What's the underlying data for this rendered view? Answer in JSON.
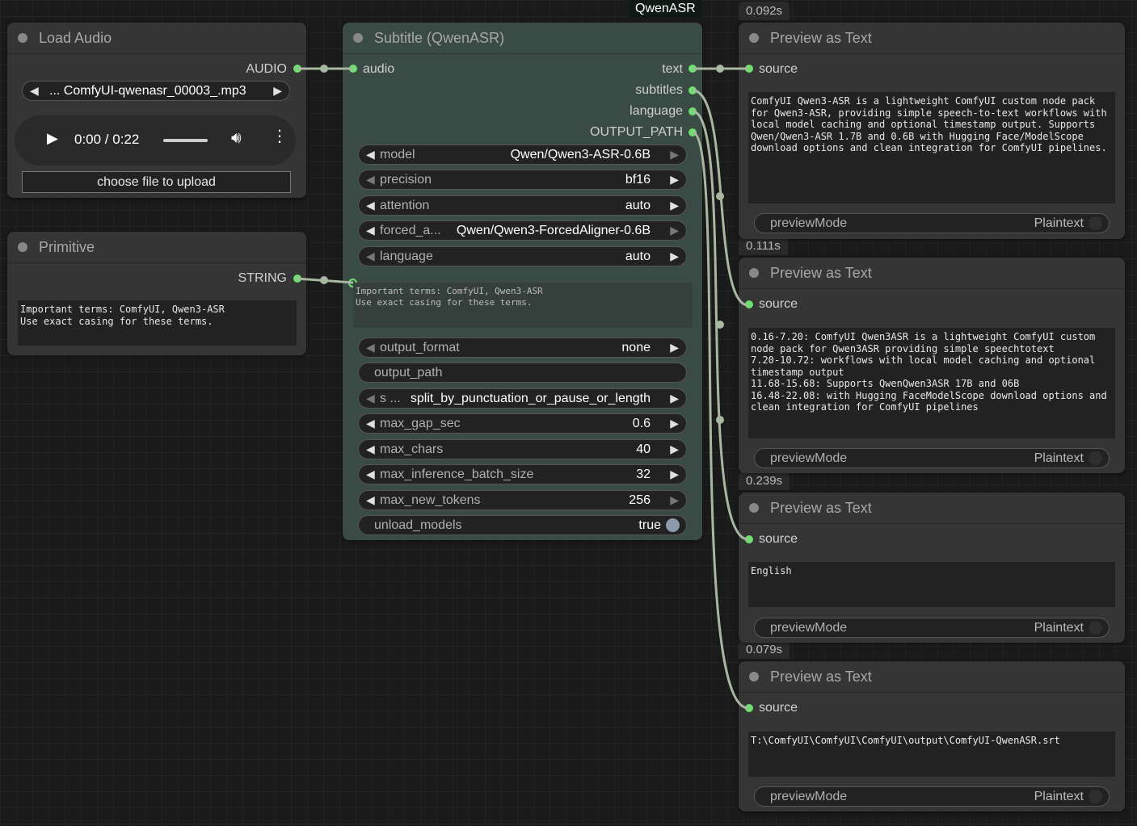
{
  "badge": "QwenASR",
  "load_audio": {
    "title": "Load Audio",
    "output_label": "AUDIO",
    "file": "... ComfyUI-qwenasr_00003_.mp3",
    "time": "0:00 / 0:22",
    "upload_label": "choose file to upload"
  },
  "primitive": {
    "title": "Primitive",
    "output_label": "STRING",
    "text": "Important terms: ComfyUI, Qwen3-ASR\nUse exact casing for these terms."
  },
  "subtitle_node": {
    "title": "Subtitle (QwenASR)",
    "input_label": "audio",
    "outputs": [
      "text",
      "subtitles",
      "language",
      "OUTPUT_PATH"
    ],
    "widgets": {
      "model": {
        "label": "model",
        "value": "Qwen/Qwen3-ASR-0.6B"
      },
      "precision": {
        "label": "precision",
        "value": "bf16"
      },
      "attention": {
        "label": "attention",
        "value": "auto"
      },
      "forced_aligner": {
        "label": "forced_a...",
        "value": "Qwen/Qwen3-ForcedAligner-0.6B"
      },
      "language": {
        "label": "language",
        "value": "auto"
      },
      "context": "Important terms: ComfyUI, Qwen3-ASR\nUse exact casing for these terms.",
      "output_format": {
        "label": "output_format",
        "value": "none"
      },
      "output_path": {
        "label": "output_path"
      },
      "split_mode": {
        "label": "s ...",
        "value": "split_by_punctuation_or_pause_or_length"
      },
      "max_gap_sec": {
        "label": "max_gap_sec",
        "value": "0.6"
      },
      "max_chars": {
        "label": "max_chars",
        "value": "40"
      },
      "max_inference_batch_size": {
        "label": "max_inference_batch_size",
        "value": "32"
      },
      "max_new_tokens": {
        "label": "max_new_tokens",
        "value": "256"
      },
      "unload_models": {
        "label": "unload_models",
        "value": "true"
      }
    }
  },
  "previews": [
    {
      "exec_time": "0.092s",
      "title": "Preview as Text",
      "input_label": "source",
      "text": "ComfyUI Qwen3-ASR is a lightweight ComfyUI custom node pack\nfor Qwen3-ASR, providing simple speech-to-text workflows with\nlocal model caching and optional timestamp output. Supports\nQwen/Qwen3-ASR 1.7B and 0.6B with Hugging Face/ModelScope\ndownload options and clean integration for ComfyUI pipelines.",
      "mode_label": "previewMode",
      "mode_value": "Plaintext"
    },
    {
      "exec_time": "0.111s",
      "title": "Preview as Text",
      "input_label": "source",
      "text": "0.16-7.20: ComfyUI Qwen3ASR is a lightweight ComfyUI custom\nnode pack for Qwen3ASR providing simple speechtotext\n7.20-10.72: workflows with local model caching and optional\ntimestamp output\n11.68-15.68: Supports QwenQwen3ASR 17B and 06B\n16.48-22.08: with Hugging FaceModelScope download options and\nclean integration for ComfyUI pipelines",
      "mode_label": "previewMode",
      "mode_value": "Plaintext"
    },
    {
      "exec_time": "0.239s",
      "title": "Preview as Text",
      "input_label": "source",
      "text": "English",
      "mode_label": "previewMode",
      "mode_value": "Plaintext"
    },
    {
      "exec_time": "0.079s",
      "title": "Preview as Text",
      "input_label": "source",
      "text": "T:\\ComfyUI\\ComfyUI\\ComfyUI\\output\\ComfyUI-QwenASR.srt",
      "mode_label": "previewMode",
      "mode_value": "Plaintext"
    }
  ],
  "colors": {
    "canvas": "#1a1a1a",
    "node": "#353535",
    "subtitle_node": "#3a4a44",
    "slot_connected": "#6ee06e",
    "wire": "#a8b8a0"
  }
}
